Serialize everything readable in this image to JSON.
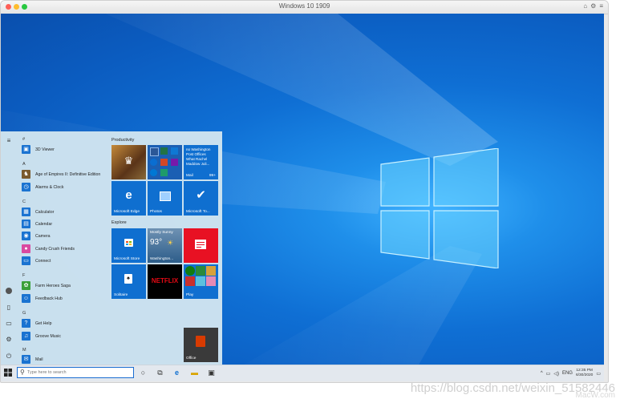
{
  "mac": {
    "title": "Windows 10 1909",
    "tools": [
      "⌂",
      "⚙",
      "≡"
    ]
  },
  "start": {
    "hamburger": "≡",
    "letters": [
      "#",
      "A",
      "C",
      "F",
      "G",
      "M"
    ],
    "apps": [
      {
        "label": "3D Viewer",
        "icon": "cube-icon",
        "glyph": "▣",
        "color": "#1a73d1"
      },
      {
        "label": "Age of Empires II: Definitive Edition",
        "icon": "game-icon",
        "glyph": "♞",
        "color": "#7a5a2c"
      },
      {
        "label": "Alarms & Clock",
        "icon": "clock-icon",
        "glyph": "◷",
        "color": "#1a73d1"
      },
      {
        "label": "Calculator",
        "icon": "calculator-icon",
        "glyph": "▦",
        "color": "#1a73d1"
      },
      {
        "label": "Calendar",
        "icon": "calendar-icon",
        "glyph": "▤",
        "color": "#1a73d1"
      },
      {
        "label": "Camera",
        "icon": "camera-icon",
        "glyph": "◉",
        "color": "#1a73d1"
      },
      {
        "label": "Candy Crush Friends",
        "icon": "candy-icon",
        "glyph": "●",
        "color": "#d94aa0"
      },
      {
        "label": "Connect",
        "icon": "connect-icon",
        "glyph": "▭",
        "color": "#1a73d1"
      },
      {
        "label": "Farm Heroes Saga",
        "icon": "farm-icon",
        "glyph": "✿",
        "color": "#3aa03a"
      },
      {
        "label": "Feedback Hub",
        "icon": "feedback-icon",
        "glyph": "☺",
        "color": "#1a73d1"
      },
      {
        "label": "Get Help",
        "icon": "help-icon",
        "glyph": "?",
        "color": "#1a73d1"
      },
      {
        "label": "Groove Music",
        "icon": "music-icon",
        "glyph": "♫",
        "color": "#1a73d1"
      },
      {
        "label": "Mail",
        "icon": "mail-icon",
        "glyph": "✉",
        "color": "#1a73d1"
      }
    ],
    "groups": [
      "Productivity",
      "Explore"
    ],
    "tiles": {
      "aoe": "",
      "office_apps": "",
      "mail_tile": {
        "lines": [
          "no Washington",
          "Post Offices",
          "What Rachel",
          "Maddow Juli..."
        ],
        "label": "Mail",
        "badge": "99+"
      },
      "edge": "Microsoft Edge",
      "photos": "Photos",
      "todo": "Microsoft To...",
      "store": "Microsoft Store",
      "weather": {
        "condition": "Mostly Sunny",
        "temp": "93°",
        "label": "Washington..."
      },
      "news": "",
      "solitaire": "Solitaire",
      "netflix": "NETFLIX",
      "play": "Play",
      "office": "Office"
    }
  },
  "taskbar": {
    "search_placeholder": "Type here to search",
    "tray": [
      "^",
      "▭",
      "◁)",
      "ENG"
    ],
    "time": "12:35 PM",
    "date": "6/30/2020"
  },
  "watermark": "https://blog.csdn.net/weixin_51582446",
  "watermark2": "MacW.com"
}
